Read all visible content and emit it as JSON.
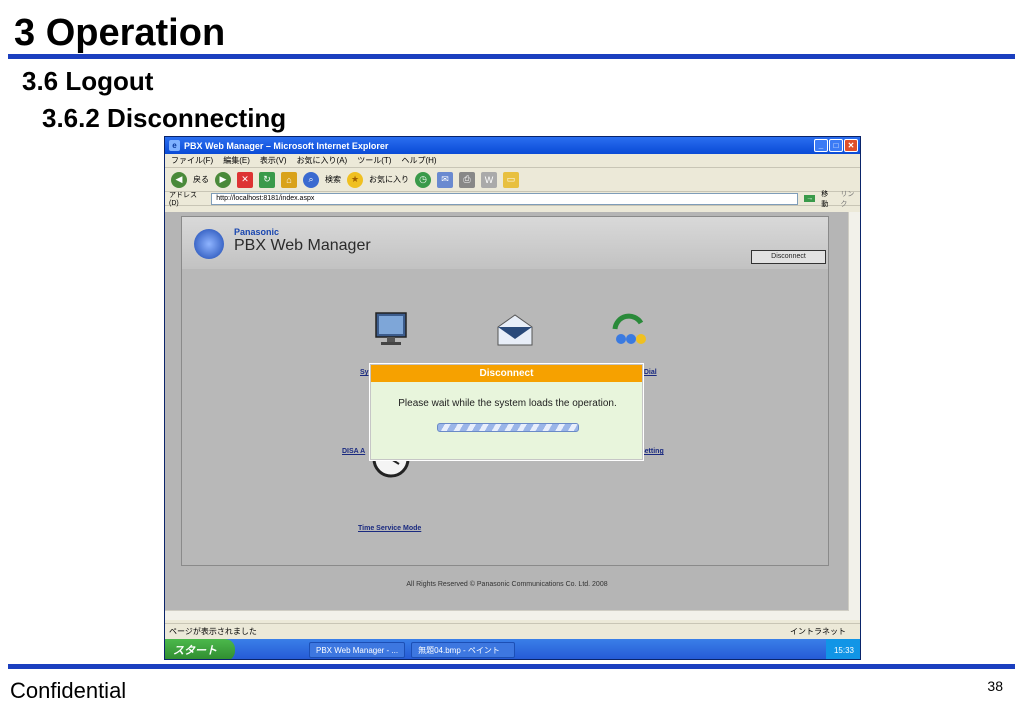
{
  "slide": {
    "heading": "3 Operation",
    "subheading": "3.6 Logout",
    "subsubheading": "3.6.2 Disconnecting",
    "footer_left": "Confidential",
    "page_number": "38"
  },
  "window": {
    "title": "PBX Web Manager – Microsoft Internet Explorer",
    "menu": [
      "ファイル(F)",
      "編集(E)",
      "表示(V)",
      "お気に入り(A)",
      "ツール(T)",
      "ヘルプ(H)"
    ],
    "toolbar": {
      "back": "戻る",
      "search": "検索",
      "favorites": "お気に入り"
    },
    "address_label": "アドレス(D)",
    "address_url": "http://localhost:8181/index.aspx",
    "go_label": "移動",
    "links_label": "リンク"
  },
  "page": {
    "brand": "Panasonic",
    "product": "PBX Web Manager",
    "disconnect_button": "Disconnect",
    "items": [
      {
        "label": "Sy"
      },
      {
        "label": "k Dial"
      },
      {
        "label": "DISA A"
      },
      {
        "label": "Setting"
      },
      {
        "label": "Time Service Mode"
      }
    ],
    "footer": "All Rights Reserved © Panasonic Communications Co. Ltd. 2008"
  },
  "modal": {
    "title": "Disconnect",
    "message": "Please wait while the system loads the operation."
  },
  "status": {
    "left": "ページが表示されました",
    "zone": "イントラネット"
  },
  "taskbar": {
    "start": "スタート",
    "items": [
      "PBX Web Manager - ...",
      "無題04.bmp - ペイント"
    ],
    "clock": "15:33"
  },
  "colors": {
    "accent_bar": "#1b3fbf",
    "modal_title": "#f6a100",
    "modal_body": "#e8f5dc"
  }
}
